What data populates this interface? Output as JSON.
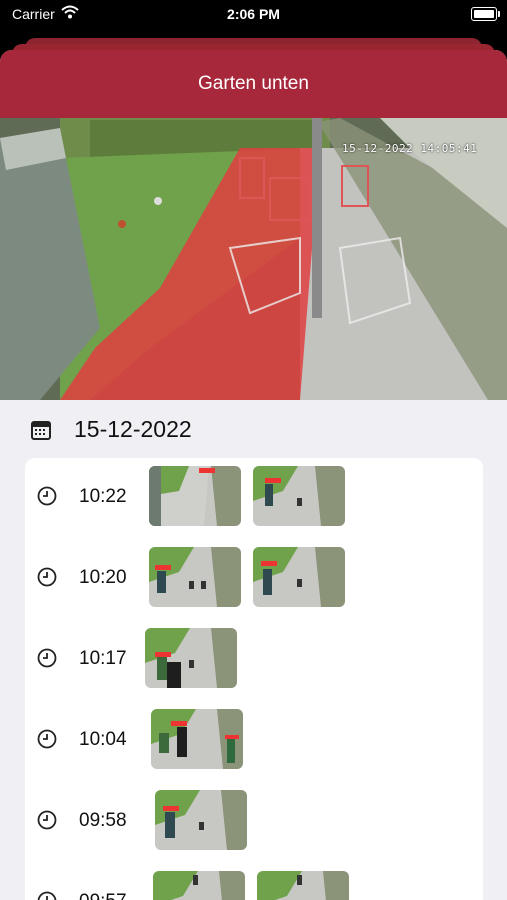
{
  "status_bar": {
    "carrier": "Carrier",
    "time": "2:06 PM"
  },
  "camera": {
    "title": "Garten unten",
    "timestamp": "15-12-2022 14:05:41"
  },
  "date_header": {
    "date": "15-12-2022"
  },
  "events": [
    {
      "time": "10:22",
      "thumbnails": 2
    },
    {
      "time": "10:20",
      "thumbnails": 2
    },
    {
      "time": "10:17",
      "thumbnails": 1
    },
    {
      "time": "10:04",
      "thumbnails": 1
    },
    {
      "time": "09:58",
      "thumbnails": 1
    },
    {
      "time": "09:57",
      "thumbnails": 2
    }
  ],
  "icons": {
    "calendar": "calendar-icon",
    "clock": "clock-icon",
    "wifi": "wifi-icon",
    "battery": "battery-icon"
  },
  "colors": {
    "header": "#a6283a",
    "zone_overlay": "#e04040",
    "background": "#f0f0f4"
  }
}
